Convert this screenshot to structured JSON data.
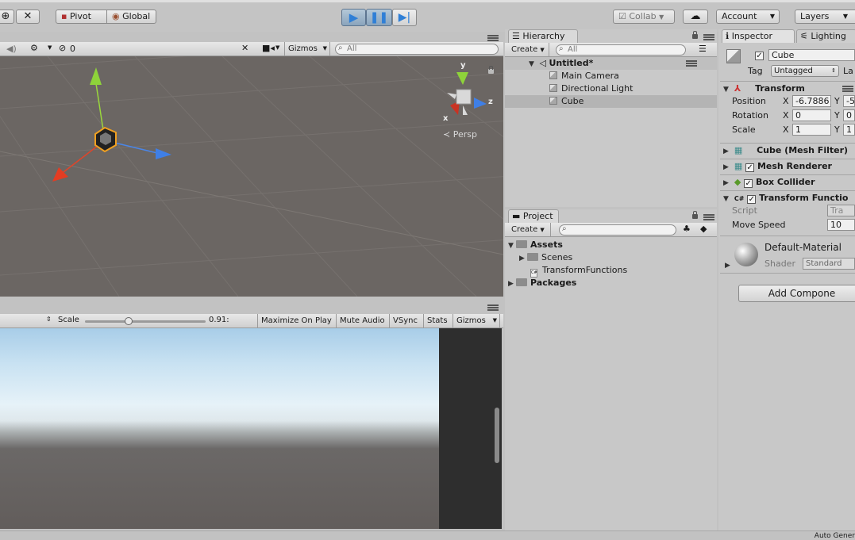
{
  "toolbar": {
    "pivot_label": "Pivot",
    "global_label": "Global",
    "collab_label": "Collab",
    "account_label": "Account",
    "layers_label": "Layers"
  },
  "scene_view": {
    "layer_count": "0",
    "gizmos_label": "Gizmos",
    "search_placeholder": "All",
    "persp_label": "Persp",
    "axis_y": "y",
    "axis_x": "x",
    "axis_z": "z"
  },
  "game_view": {
    "scale_label": "Scale",
    "scale_value": "0.91:",
    "scale_fraction": 0.36,
    "maximize_label": "Maximize On Play",
    "mute_label": "Mute Audio",
    "vsync_label": "VSync",
    "stats_label": "Stats",
    "gizmos_label": "Gizmos"
  },
  "hierarchy": {
    "tab_label": "Hierarchy",
    "create_label": "Create",
    "search_placeholder": "All",
    "scene_name": "Untitled*",
    "items": [
      {
        "label": "Main Camera"
      },
      {
        "label": "Directional Light"
      },
      {
        "label": "Cube"
      }
    ]
  },
  "project": {
    "tab_label": "Project",
    "create_label": "Create",
    "assets_label": "Assets",
    "scenes_label": "Scenes",
    "script_label": "TransformFunctions",
    "packages_label": "Packages"
  },
  "inspector": {
    "tab_label": "Inspector",
    "lighting_tab_label": "Lighting",
    "object_name": "Cube",
    "tag_label": "Tag",
    "tag_value": "Untagged",
    "layer_label_partial": "La",
    "transform_label": "Transform",
    "position_label": "Position",
    "rotation_label": "Rotation",
    "scale_label": "Scale",
    "x_label": "X",
    "y_label": "Y",
    "position_x": "-6.7886",
    "position_y": "-5",
    "rotation_x": "0",
    "rotation_y": "0",
    "scale_x": "1",
    "scale_y": "1",
    "mesh_filter_label": "Cube (Mesh Filter)",
    "mesh_renderer_label": "Mesh Renderer",
    "box_collider_label": "Box Collider",
    "transform_functions_label": "Transform Functio",
    "script_field_label": "Script",
    "script_value": "Tra",
    "move_speed_label": "Move Speed",
    "move_speed_value": "10",
    "material_name": "Default-Material",
    "shader_label": "Shader",
    "shader_value": "Standard",
    "add_component_label": "Add Compone"
  },
  "status_bar": {
    "right_text": "Auto Gener"
  },
  "colors": {
    "play_blue": "#2f7fd6",
    "scene_grid": "#6a6562",
    "selection": "#b4b4b4"
  }
}
